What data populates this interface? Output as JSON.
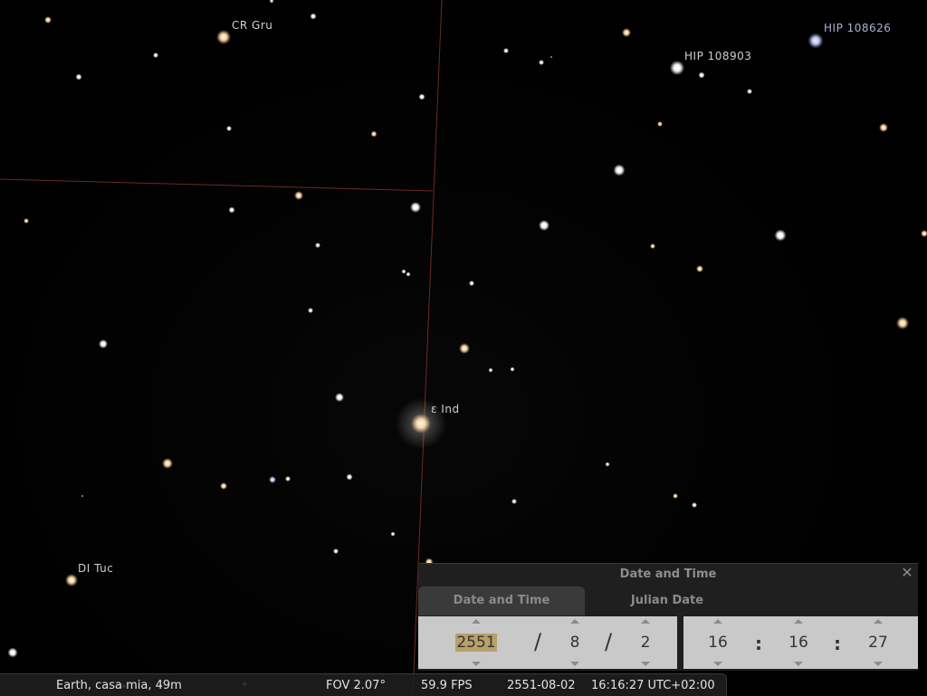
{
  "labels": {
    "cr_gru": "CR Gru",
    "hip_108626": "HIP 108626",
    "hip_108903": "HIP 108903",
    "eps_ind": "ε Ind",
    "di_tuc": "DI Tuc"
  },
  "dialog": {
    "title": "Date and Time",
    "close_icon": "close-icon",
    "tabs": [
      "Date and Time",
      "Julian Date"
    ],
    "date": {
      "year": "2551",
      "month": "8",
      "day": "2",
      "separator": "/"
    },
    "time": {
      "hour": "16",
      "minute": "16",
      "second": "27",
      "separator": ":"
    }
  },
  "status_bar": {
    "location": "Earth, casa mia, 49m",
    "fov": "FOV 2.07°",
    "fps": "59.9 FPS",
    "date": "2551-08-02",
    "time": "16:16:27 UTC+02:00"
  },
  "colors": {
    "sky": "#000000",
    "constellation_boundary": "#6b2a22",
    "dialog_bg": "#222222",
    "tab_active": "#3a3a3a",
    "spin_box": "#c9c9c9",
    "selected_highlight": "#b8a06a"
  }
}
